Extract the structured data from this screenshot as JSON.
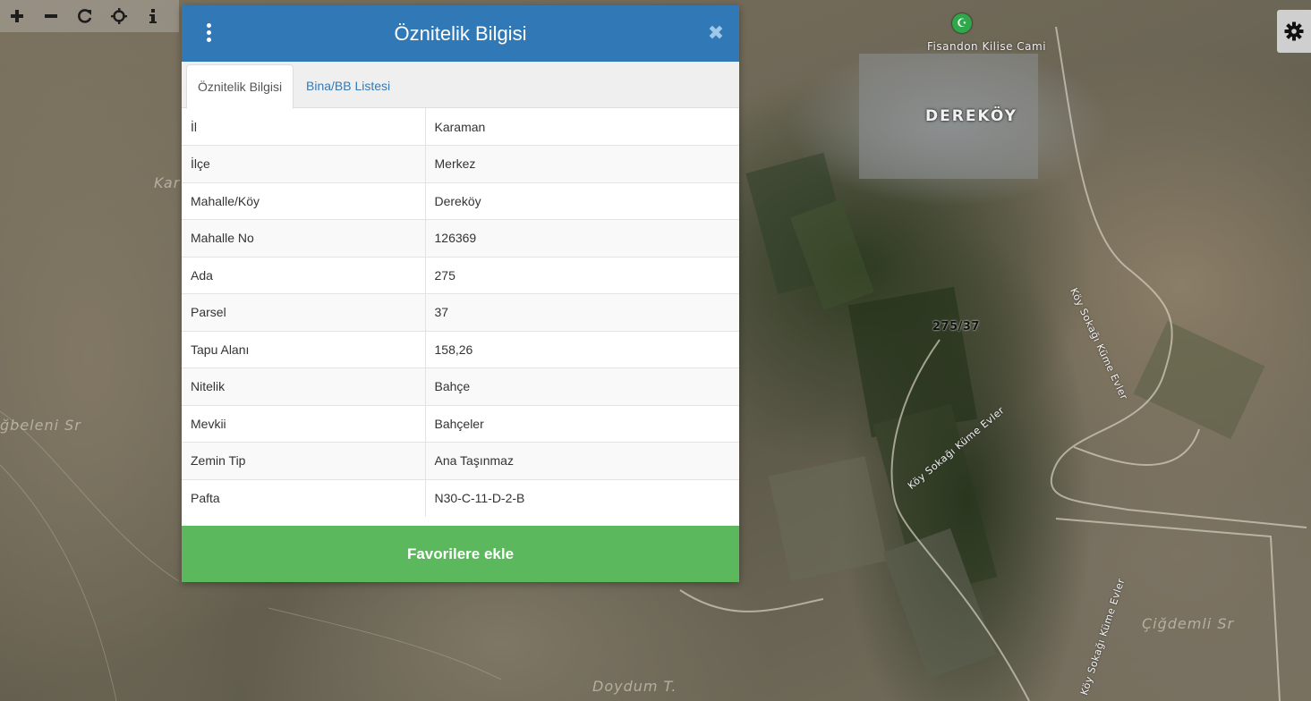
{
  "toolbar": {
    "buttons": [
      {
        "icon": "plus-icon",
        "glyph": "+"
      },
      {
        "icon": "minus-icon",
        "glyph": "−"
      },
      {
        "icon": "refresh-icon",
        "glyph": "⟳"
      },
      {
        "icon": "crosshair-icon",
        "glyph": "⌖"
      },
      {
        "icon": "info-icon",
        "glyph": "i"
      }
    ],
    "settings_icon": "gear-icon"
  },
  "map": {
    "village_label": "DEREKÖY",
    "poi_label": "Fisandon Kilise Cami",
    "parcel_label": "275/37",
    "road_label_1": "Köy Sokağı Küme Evler",
    "road_label_2": "Köy Sokağı Küme Evler",
    "road_label_3": "Köy Sokağı Küme Evler",
    "area_label_1": "Kar",
    "area_label_2": "ğbeleni Sr",
    "area_label_3": "Çiğdemli Sr",
    "area_label_4": "Doydum T."
  },
  "dialog": {
    "title": "Öznitelik Bilgisi",
    "close_glyph": "✖",
    "tabs": [
      {
        "label": "Öznitelik Bilgisi",
        "active": true
      },
      {
        "label": "Bina/BB Listesi",
        "active": false
      }
    ],
    "rows": [
      {
        "key": "İl",
        "value": "Karaman"
      },
      {
        "key": "İlçe",
        "value": "Merkez"
      },
      {
        "key": "Mahalle/Köy",
        "value": "Dereköy"
      },
      {
        "key": "Mahalle No",
        "value": "126369"
      },
      {
        "key": "Ada",
        "value": "275"
      },
      {
        "key": "Parsel",
        "value": "37"
      },
      {
        "key": "Tapu Alanı",
        "value": "158,26"
      },
      {
        "key": "Nitelik",
        "value": "Bahçe"
      },
      {
        "key": "Mevkii",
        "value": "Bahçeler"
      },
      {
        "key": "Zemin Tip",
        "value": "Ana Taşınmaz"
      },
      {
        "key": "Pafta",
        "value": "N30-C-11-D-2-B"
      }
    ],
    "favorite_button": "Favorilere ekle"
  },
  "colors": {
    "header_blue": "#3179b6",
    "link_blue": "#337ab7",
    "favorite_green": "#5cb85c"
  }
}
